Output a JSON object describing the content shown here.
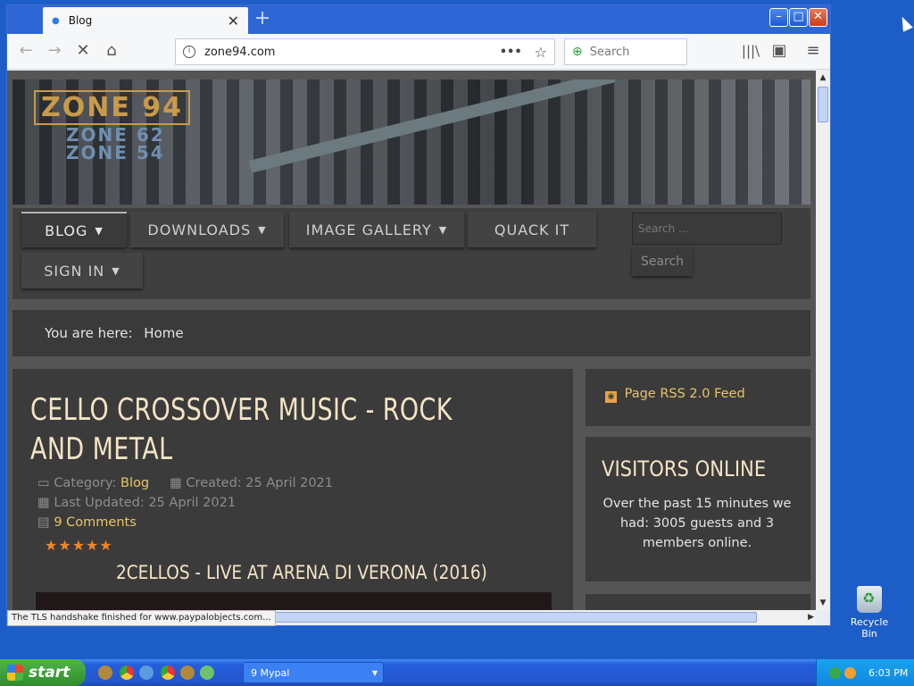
{
  "desktop": {
    "recycle_label": "Recycle Bin"
  },
  "browser": {
    "tab_title": "Blog",
    "tab_close": "✕",
    "new_tab": "+",
    "url": "zone94.com",
    "search_placeholder": "Search",
    "status_text": "The TLS handshake finished for www.paypalobjects.com..."
  },
  "site": {
    "logo_main": "ZONE 94",
    "logo_sub1": "ZONE 62",
    "logo_sub2": "ZONE 54",
    "menu": {
      "blog": "BLOG",
      "downloads": "DOWNLOADS",
      "gallery": "IMAGE GALLERY",
      "quack": "QUACK IT",
      "signin": "SIGN IN",
      "search_placeholder": "Search ...",
      "search_button": "Search"
    },
    "breadcrumb": {
      "prefix": "You are here:",
      "home": "Home"
    },
    "article": {
      "title": "CELLO CROSSOVER MUSIC - ROCK AND METAL",
      "category_label": "Category:",
      "category": "Blog",
      "created": "Created: 25 April 2021",
      "updated": "Last Updated: 25 April 2021",
      "comments": "9 Comments",
      "rating": 5,
      "stars": "★★★★★",
      "subtitle": "2CELLOS - LIVE AT ARENA DI VERONA (2016)"
    },
    "sidebar": {
      "rss": "Page RSS 2.0 Feed",
      "visitors_title": "VISITORS ONLINE",
      "visitors_text": "Over the past 15 minutes we had: 3005 guests and 3 members online."
    }
  },
  "taskbar": {
    "start": "start",
    "task_item": "9 Mypal",
    "clock": "6:03 PM"
  }
}
